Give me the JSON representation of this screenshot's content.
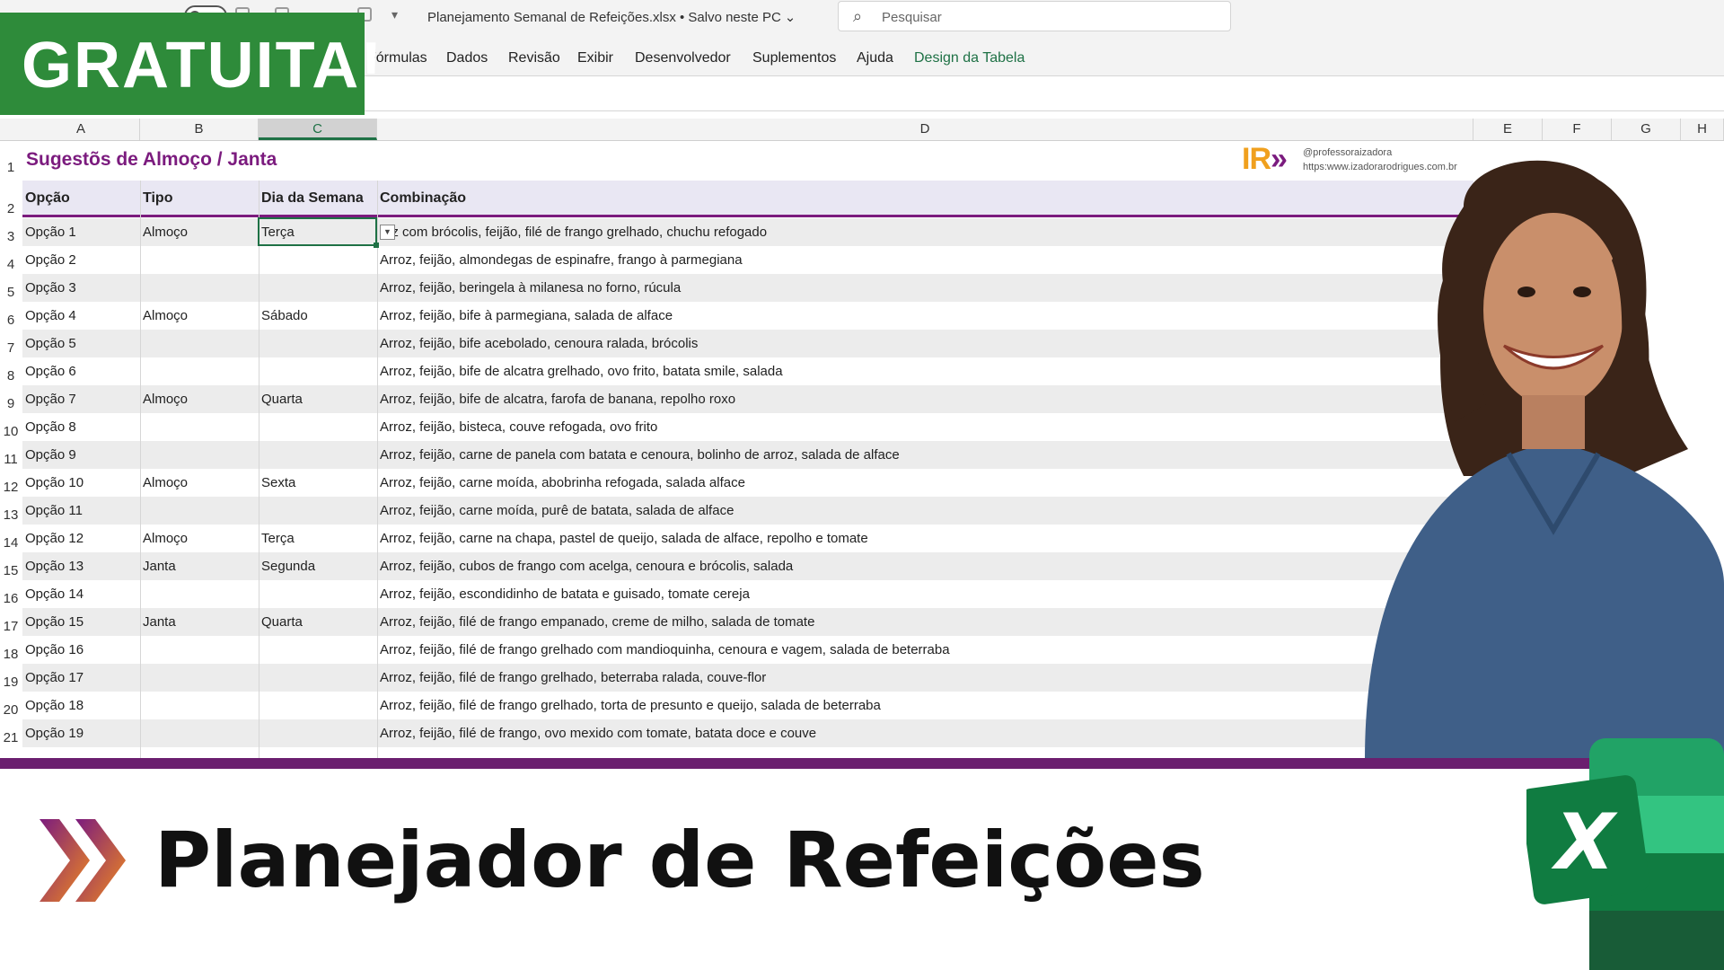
{
  "titlebar": {
    "document_title": "Planejamento Semanal de Refeições.xlsx  •  Salvo neste PC",
    "search_placeholder": "Pesquisar"
  },
  "ribbon": {
    "tabs": [
      "Fórmulas",
      "Dados",
      "Revisão",
      "Exibir",
      "Desenvolvedor",
      "Suplementos",
      "Ajuda",
      "Design da Tabela"
    ]
  },
  "badge": {
    "label": "GRATUITA!"
  },
  "columns": [
    "A",
    "B",
    "C",
    "D",
    "E",
    "F",
    "G",
    "H"
  ],
  "row_numbers": [
    "1",
    "2",
    "3",
    "4",
    "5",
    "6",
    "7",
    "8",
    "9",
    "10",
    "11",
    "12",
    "13",
    "14",
    "15",
    "16",
    "17",
    "18",
    "19",
    "20",
    "21"
  ],
  "sheet": {
    "title": "Sugestõs de Almoço / Janta",
    "headers": {
      "opcao": "Opção",
      "tipo": "Tipo",
      "dia": "Dia da Semana",
      "combinacao": "Combinação"
    },
    "rows": [
      {
        "opcao": "Opção 1",
        "tipo": "Almoço",
        "dia": "Terça",
        "combinacao": "roz com brócolis, feijão, filé de frango grelhado, chuchu refogado"
      },
      {
        "opcao": "Opção 2",
        "tipo": "",
        "dia": "",
        "combinacao": "Arroz, feijão, almondegas de espinafre, frango à parmegiana"
      },
      {
        "opcao": "Opção 3",
        "tipo": "",
        "dia": "",
        "combinacao": "Arroz, feijão, beringela à milanesa no forno, rúcula"
      },
      {
        "opcao": "Opção 4",
        "tipo": "Almoço",
        "dia": "Sábado",
        "combinacao": "Arroz, feijão, bife à parmegiana, salada de alface"
      },
      {
        "opcao": "Opção 5",
        "tipo": "",
        "dia": "",
        "combinacao": "Arroz, feijão, bife acebolado, cenoura ralada, brócolis"
      },
      {
        "opcao": "Opção 6",
        "tipo": "",
        "dia": "",
        "combinacao": "Arroz, feijão, bife de alcatra grelhado, ovo frito, batata smile, salada"
      },
      {
        "opcao": "Opção 7",
        "tipo": "Almoço",
        "dia": "Quarta",
        "combinacao": "Arroz, feijão, bife de alcatra, farofa de banana, repolho roxo"
      },
      {
        "opcao": "Opção 8",
        "tipo": "",
        "dia": "",
        "combinacao": "Arroz, feijão, bisteca, couve refogada, ovo frito"
      },
      {
        "opcao": "Opção 9",
        "tipo": "",
        "dia": "",
        "combinacao": "Arroz, feijão, carne de panela com batata e cenoura, bolinho de arroz, salada de alface"
      },
      {
        "opcao": "Opção 10",
        "tipo": "Almoço",
        "dia": "Sexta",
        "combinacao": "Arroz, feijão, carne moída, abobrinha refogada, salada alface"
      },
      {
        "opcao": "Opção 11",
        "tipo": "",
        "dia": "",
        "combinacao": "Arroz, feijão, carne moída, purê de batata, salada de alface"
      },
      {
        "opcao": "Opção 12",
        "tipo": "Almoço",
        "dia": "Terça",
        "combinacao": "Arroz, feijão, carne na chapa, pastel de queijo, salada de alface, repolho e tomate"
      },
      {
        "opcao": "Opção 13",
        "tipo": "Janta",
        "dia": "Segunda",
        "combinacao": "Arroz, feijão, cubos de frango com acelga, cenoura e brócolis, salada"
      },
      {
        "opcao": "Opção 14",
        "tipo": "",
        "dia": "",
        "combinacao": "Arroz, feijão, escondidinho de batata e guisado, tomate cereja"
      },
      {
        "opcao": "Opção 15",
        "tipo": "Janta",
        "dia": "Quarta",
        "combinacao": "Arroz, feijão, filé de frango empanado, creme de milho, salada de tomate"
      },
      {
        "opcao": "Opção 16",
        "tipo": "",
        "dia": "",
        "combinacao": "Arroz, feijão, filé de frango grelhado com mandioquinha, cenoura e vagem, salada de beterraba"
      },
      {
        "opcao": "Opção 17",
        "tipo": "",
        "dia": "",
        "combinacao": "Arroz, feijão, filé de frango grelhado, beterraba ralada, couve-flor"
      },
      {
        "opcao": "Opção 18",
        "tipo": "",
        "dia": "",
        "combinacao": "Arroz, feijão, filé de frango grelhado, torta de presunto e queijo, salada de beterraba"
      },
      {
        "opcao": "Opção 19",
        "tipo": "",
        "dia": "",
        "combinacao": "Arroz, feijão, filé de frango, ovo mexido com tomate, batata doce e couve"
      }
    ]
  },
  "logo": {
    "mark": "IR",
    "handle": "@professoraizadora",
    "url": "https:www.izadorarodrigues.com.br"
  },
  "banner": {
    "title": "Planejador de Refeições"
  },
  "colors": {
    "excel_green": "#1e7145",
    "purple": "#7b1b7e",
    "badge_green": "#2e8b3a"
  }
}
